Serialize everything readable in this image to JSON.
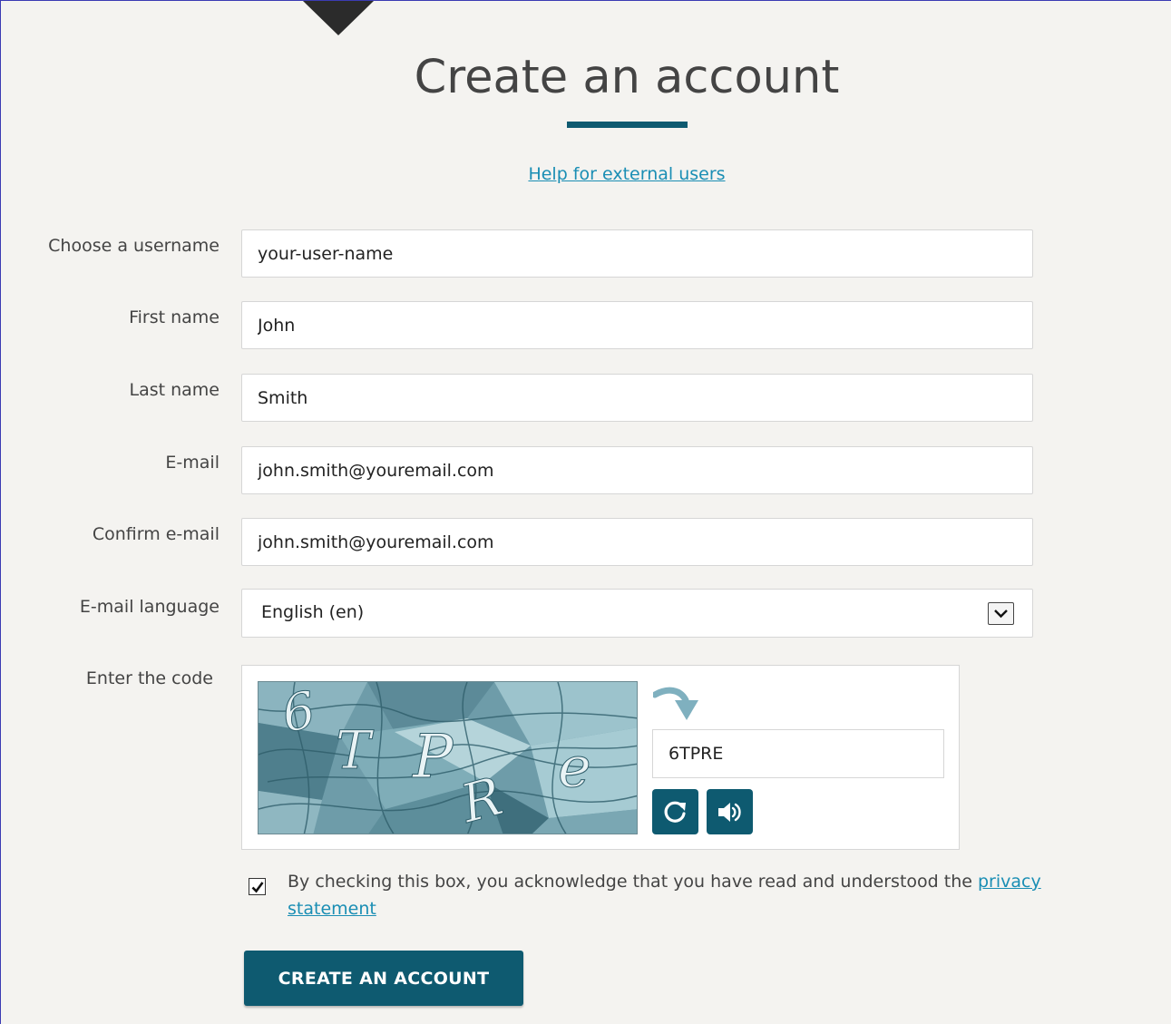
{
  "page": {
    "title": "Create an account",
    "help_link": "Help for external users"
  },
  "form": {
    "username": {
      "label": "Choose a username",
      "value": "your-user-name"
    },
    "first_name": {
      "label": "First name",
      "value": "John"
    },
    "last_name": {
      "label": "Last name",
      "value": "Smith"
    },
    "email": {
      "label": "E-mail",
      "value": "john.smith@youremail.com"
    },
    "confirm_email": {
      "label": "Confirm e-mail",
      "value": "john.smith@youremail.com"
    },
    "language": {
      "label": "E-mail language",
      "value": "English (en)"
    },
    "captcha": {
      "label": "Enter the code",
      "value": "6TPRE"
    },
    "consent": {
      "text": "By checking this box, you acknowledge that you have read and understood the ",
      "link": "privacy statement",
      "checked": true
    },
    "submit_label": "CREATE AN ACCOUNT"
  },
  "icons": {
    "reload": "curved-arrow-icon",
    "refresh": "refresh-icon",
    "audio": "speaker-icon",
    "dropdown": "chevron-down-icon",
    "check": "check-icon"
  },
  "colors": {
    "accent": "#0e5a70",
    "link": "#1a8eb4",
    "background": "#f4f3f0"
  }
}
